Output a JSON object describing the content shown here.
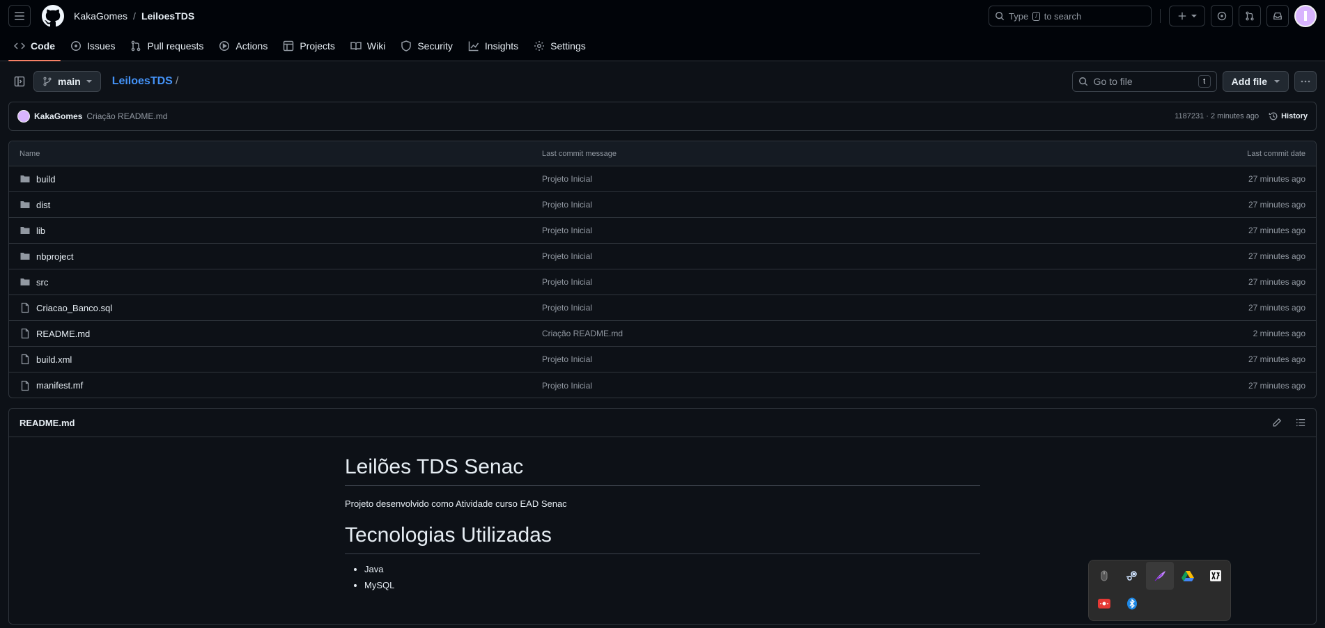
{
  "header": {
    "owner": "KakaGomes",
    "separator": "/",
    "repo": "LeiloesTDS",
    "search": {
      "prefix": "Type",
      "key": "/",
      "suffix": "to search"
    }
  },
  "tabs": [
    {
      "label": "Code",
      "icon": "code-icon",
      "active": true
    },
    {
      "label": "Issues",
      "icon": "issue-icon"
    },
    {
      "label": "Pull requests",
      "icon": "pull-request-icon"
    },
    {
      "label": "Actions",
      "icon": "play-icon"
    },
    {
      "label": "Projects",
      "icon": "table-icon"
    },
    {
      "label": "Wiki",
      "icon": "book-icon"
    },
    {
      "label": "Security",
      "icon": "shield-icon"
    },
    {
      "label": "Insights",
      "icon": "graph-icon"
    },
    {
      "label": "Settings",
      "icon": "gear-icon"
    }
  ],
  "filebar": {
    "branch": "main",
    "path": "LeiloesTDS",
    "path_sep": "/",
    "goto_placeholder": "Go to file",
    "goto_key": "t",
    "add_file": "Add file"
  },
  "commit": {
    "author": "KakaGomes",
    "message": "Criação README.md",
    "meta": "1187231 · 2 minutes ago",
    "history": "History"
  },
  "table": {
    "headers": {
      "name": "Name",
      "message": "Last commit message",
      "date": "Last commit date"
    },
    "rows": [
      {
        "name": "build",
        "type": "folder",
        "message": "Projeto Inicial",
        "date": "27 minutes ago"
      },
      {
        "name": "dist",
        "type": "folder",
        "message": "Projeto Inicial",
        "date": "27 minutes ago"
      },
      {
        "name": "lib",
        "type": "folder",
        "message": "Projeto Inicial",
        "date": "27 minutes ago"
      },
      {
        "name": "nbproject",
        "type": "folder",
        "message": "Projeto Inicial",
        "date": "27 minutes ago"
      },
      {
        "name": "src",
        "type": "folder",
        "message": "Projeto Inicial",
        "date": "27 minutes ago"
      },
      {
        "name": "Criacao_Banco.sql",
        "type": "file",
        "message": "Projeto Inicial",
        "date": "27 minutes ago"
      },
      {
        "name": "README.md",
        "type": "file",
        "message": "Criação README.md",
        "date": "2 minutes ago"
      },
      {
        "name": "build.xml",
        "type": "file",
        "message": "Projeto Inicial",
        "date": "27 minutes ago"
      },
      {
        "name": "manifest.mf",
        "type": "file",
        "message": "Projeto Inicial",
        "date": "27 minutes ago"
      }
    ]
  },
  "readme": {
    "filename": "README.md",
    "h1": "Leilões TDS Senac",
    "paragraph": "Projeto desenvolvido como Atividade curso EAD Senac",
    "h2": "Tecnologias Utilizadas",
    "items": [
      "Java",
      "MySQL"
    ]
  },
  "tray": {
    "icons": [
      "mouse-icon",
      "steam-icon",
      "feather-icon",
      "google-drive-icon",
      "app-icon",
      "recording-icon",
      "bluetooth-icon"
    ]
  },
  "colors": {
    "accent": "#4493f8",
    "tab_underline": "#f78166",
    "background": "#0d1117",
    "header_bg": "#010409"
  }
}
